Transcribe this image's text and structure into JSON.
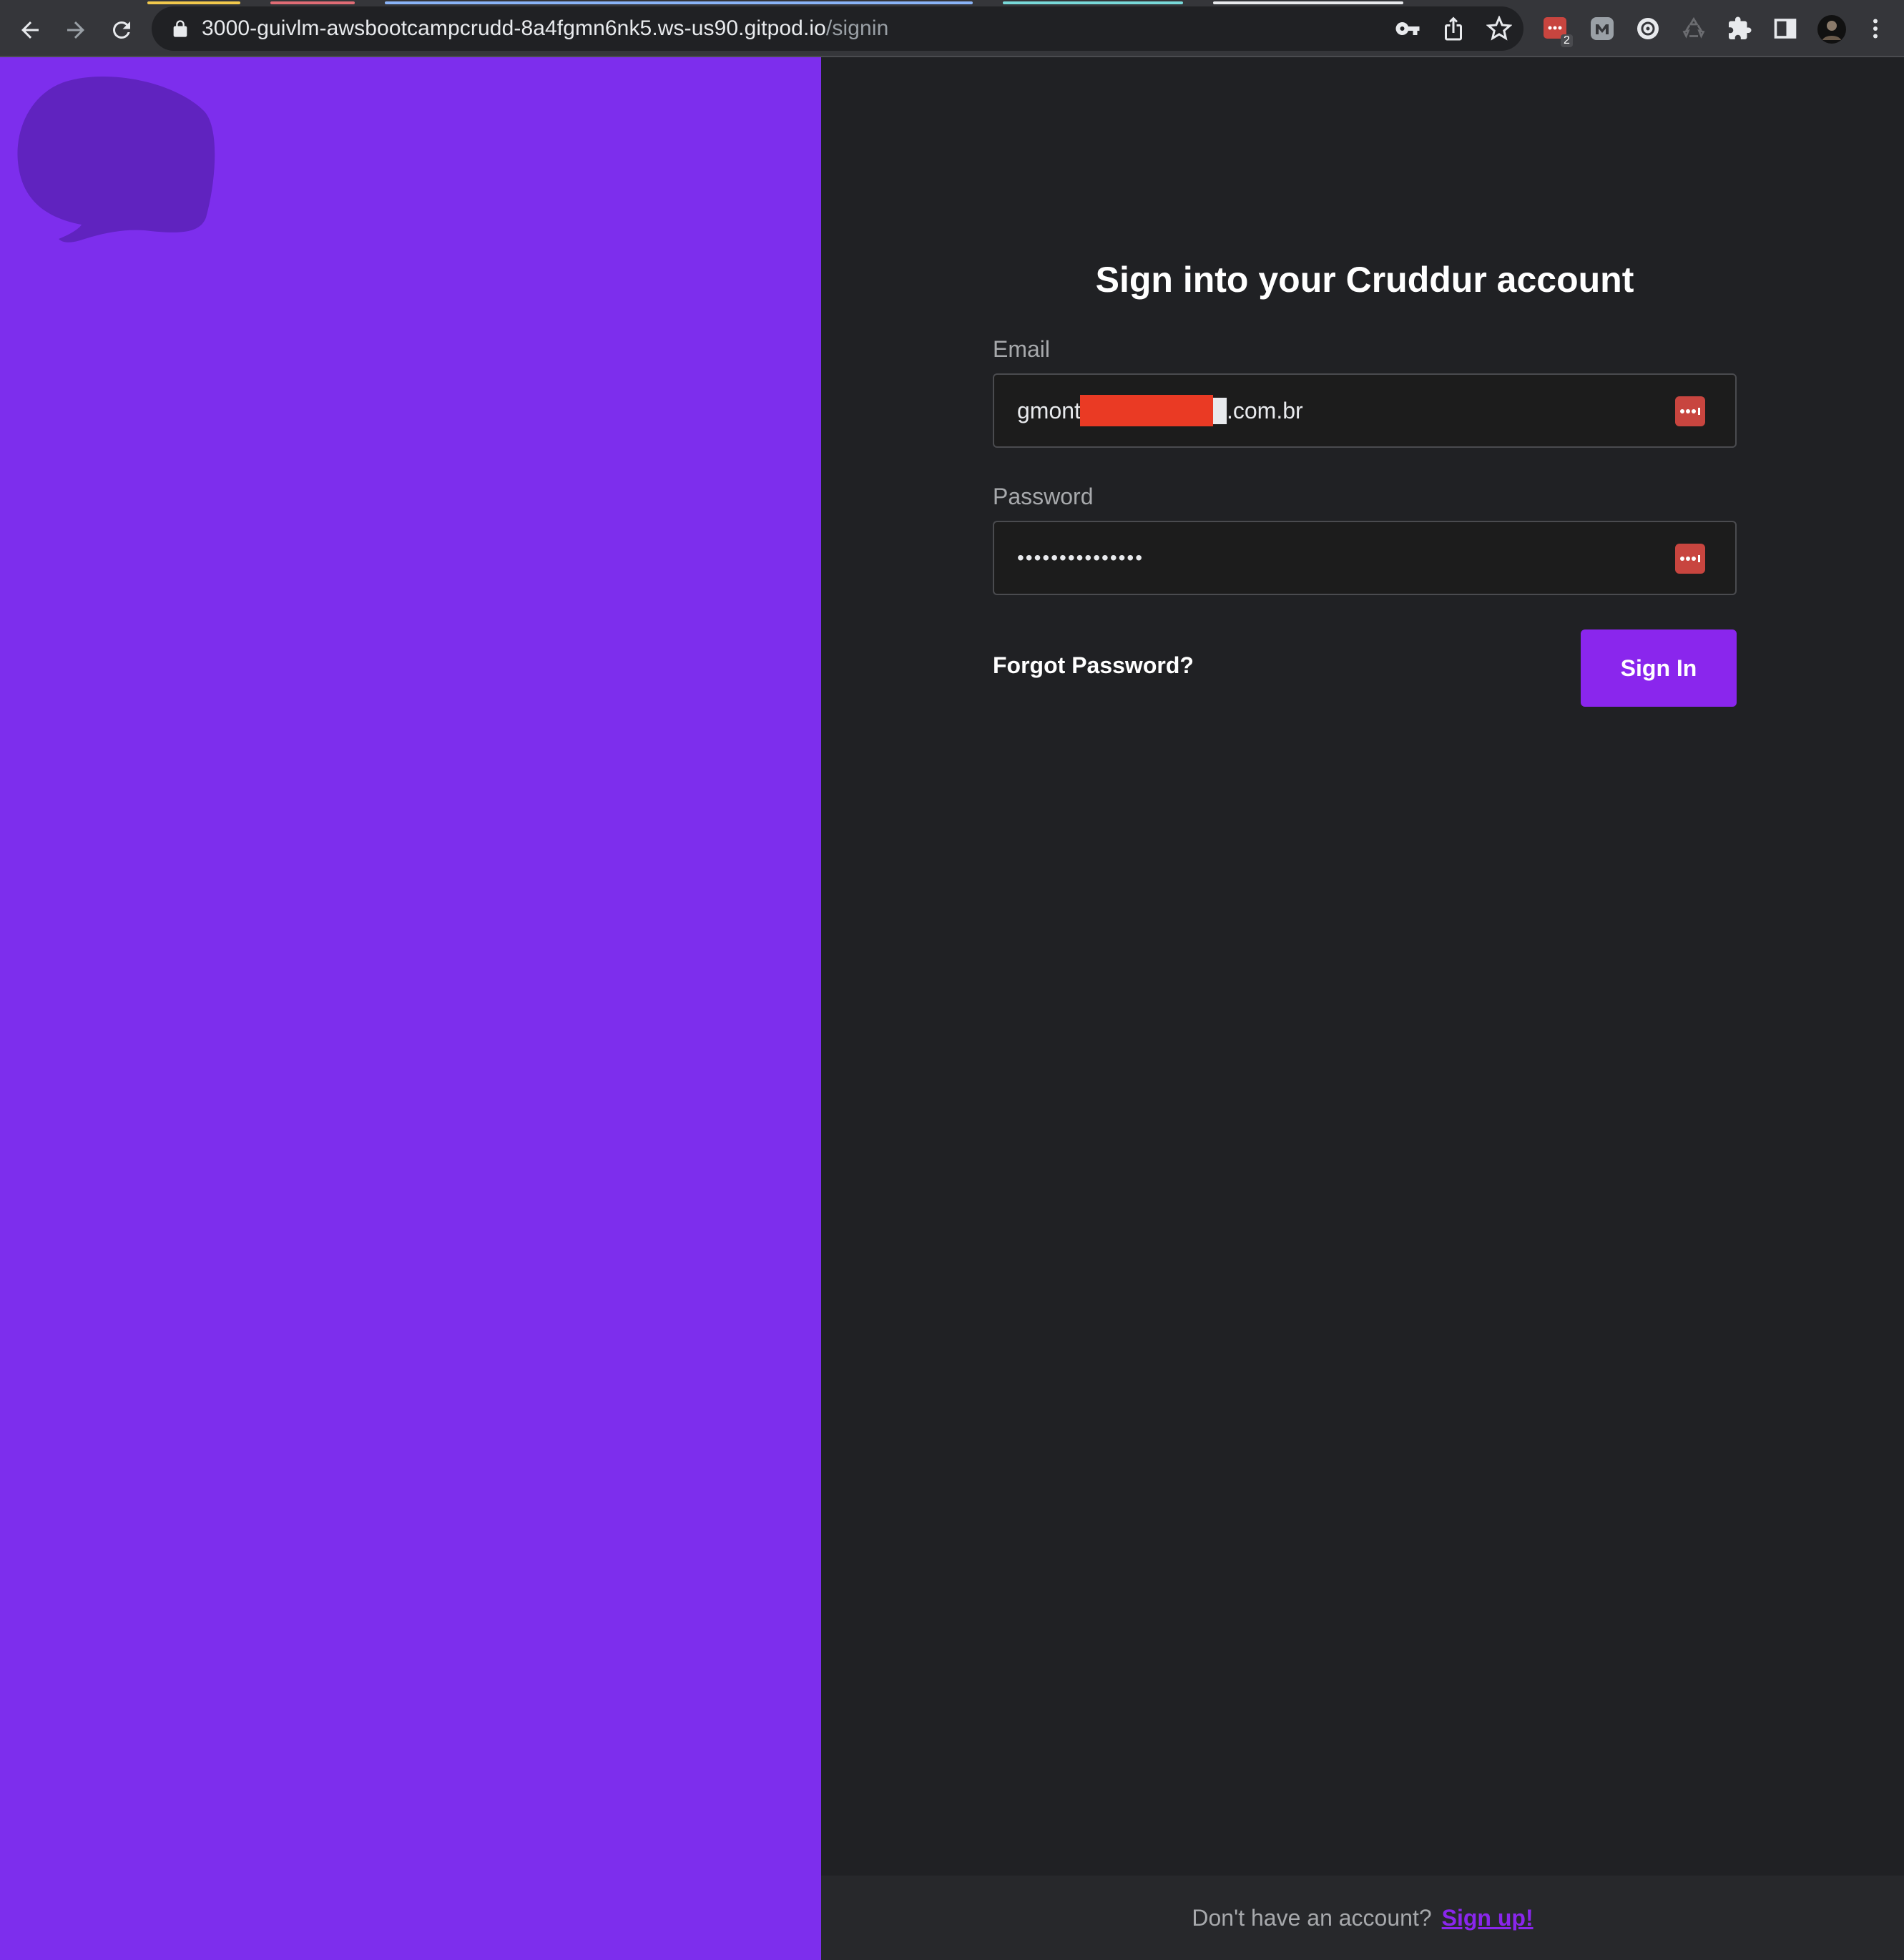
{
  "browser": {
    "url_host": "3000-guivlm-awsbootcampcrudd-8a4fgmn6nk5.ws-us90.gitpod.io",
    "url_path": "/signin",
    "extension_badge": "2",
    "icons": [
      "back-icon",
      "forward-icon",
      "reload-icon",
      "lock-icon",
      "key-icon",
      "share-icon",
      "star-icon",
      "password-manager-extension-icon",
      "m-extension-icon",
      "globe-extension-icon",
      "recycle-extension-icon",
      "puzzle-extension-icon",
      "side-panel-icon",
      "profile-avatar",
      "menu-kebab-icon"
    ]
  },
  "brand": {
    "primary": "#7d2eed",
    "button": "#8a26ed",
    "background": "#202124"
  },
  "signin": {
    "title": "Sign into your Cruddur account",
    "email_label": "Email",
    "email_value": "gmont█████████.com.br",
    "password_label": "Password",
    "password_value": "•••••••••••••••",
    "forgot_label": "Forgot Password?",
    "submit_label": "Sign In"
  },
  "footer": {
    "question": "Don't have an account?",
    "signup_label": "Sign up!"
  }
}
